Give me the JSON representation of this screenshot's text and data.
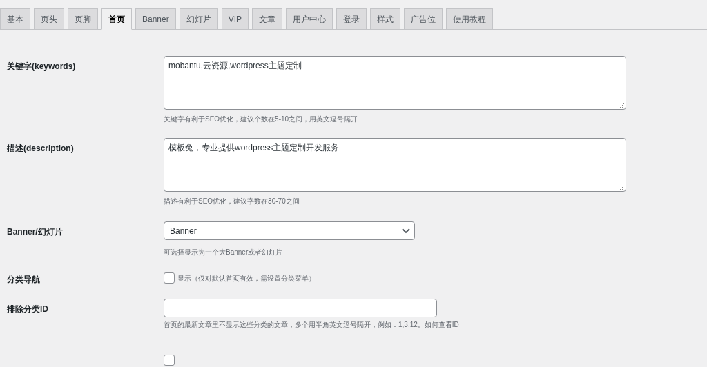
{
  "tabs": [
    {
      "label": "基本",
      "selected": false
    },
    {
      "label": "页头",
      "selected": false
    },
    {
      "label": "页脚",
      "selected": false
    },
    {
      "label": "首页",
      "selected": true
    },
    {
      "label": "Banner",
      "selected": false
    },
    {
      "label": "幻灯片",
      "selected": false
    },
    {
      "label": "VIP",
      "selected": false
    },
    {
      "label": "文章",
      "selected": false
    },
    {
      "label": "用户中心",
      "selected": false
    },
    {
      "label": "登录",
      "selected": false
    },
    {
      "label": "样式",
      "selected": false
    },
    {
      "label": "广告位",
      "selected": false
    },
    {
      "label": "使用教程",
      "selected": false
    }
  ],
  "fields": [
    {
      "kind": "textarea",
      "label": "关键字(keywords)",
      "value": "mobantu,云资源,wordpress主题定制",
      "hint": "关键字有利于SEO优化，建议个数在5-10之间，用英文逗号隔开"
    },
    {
      "kind": "textarea",
      "label": "描述(description)",
      "value": "模板兔，专业提供wordpress主题定制开发服务",
      "hint": "描述有利于SEO优化，建议字数在30-70之间"
    },
    {
      "kind": "select",
      "label": "Banner/幻灯片",
      "value": "Banner",
      "hint": "可选择显示为一个大Banner或者幻灯片"
    },
    {
      "kind": "checkbox",
      "label": "分类导航",
      "checked": false,
      "text": "显示（仅对默认首页有效，需设置分类菜单）"
    },
    {
      "kind": "input",
      "label": "排除分类ID",
      "hint": "首页的最新文章里不显示这些分类的文章，多个用半角英文逗号隔开，例如：1,3,12。如何查看ID"
    },
    {
      "kind": "checkbox",
      "checked": false
    }
  ]
}
